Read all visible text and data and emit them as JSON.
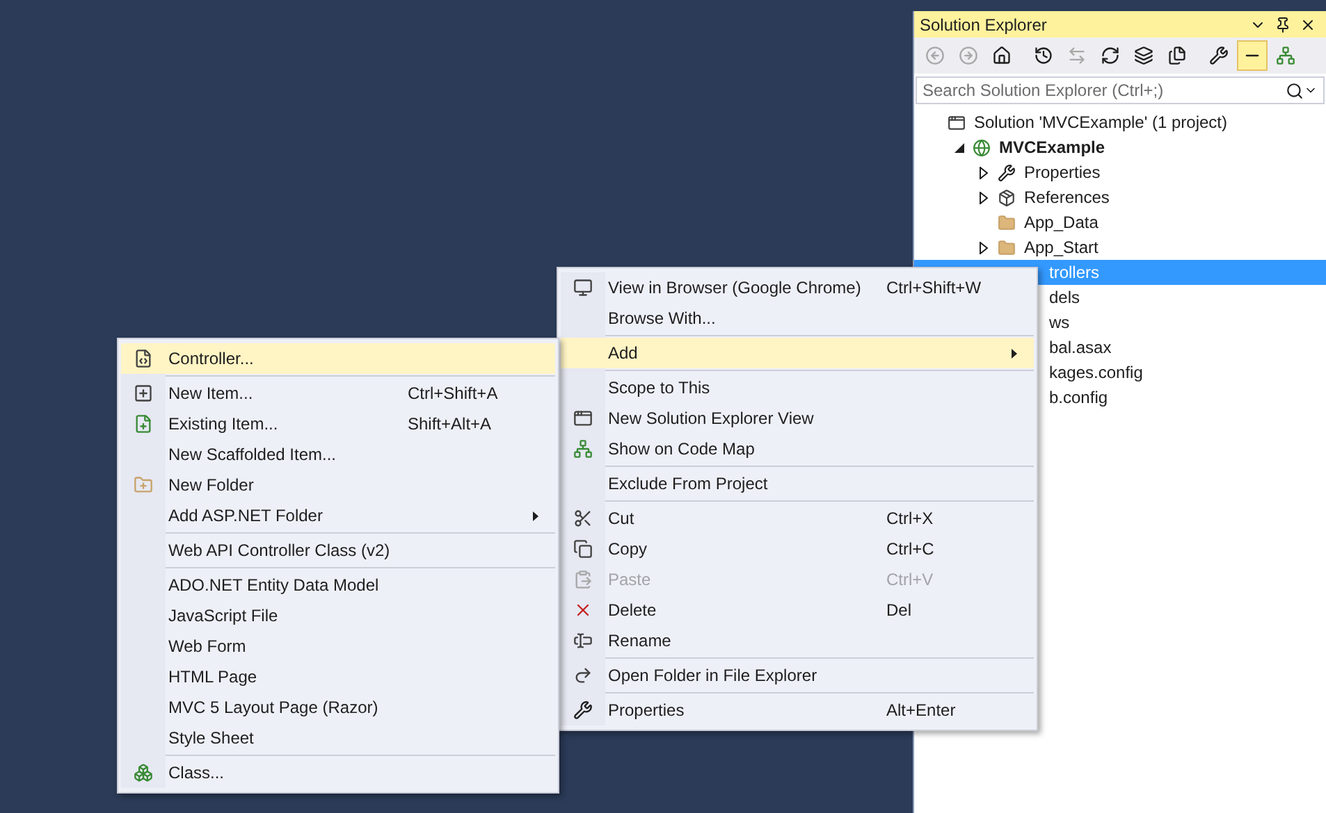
{
  "solution_explorer": {
    "title": "Solution Explorer",
    "toolbar": [
      {
        "kind": "back",
        "disabled": true,
        "pressed": false
      },
      {
        "kind": "forward",
        "disabled": true,
        "pressed": false
      },
      {
        "kind": "home",
        "disabled": false,
        "pressed": false
      },
      {
        "kind": "history",
        "disabled": false,
        "pressed": false
      },
      {
        "kind": "sync",
        "disabled": true,
        "pressed": false
      },
      {
        "kind": "refresh",
        "disabled": false,
        "pressed": false
      },
      {
        "kind": "collapse",
        "disabled": false,
        "pressed": false
      },
      {
        "kind": "show-all",
        "disabled": false,
        "pressed": false
      },
      {
        "kind": "properties",
        "disabled": false,
        "pressed": false
      },
      {
        "kind": "preview",
        "disabled": false,
        "pressed": true
      },
      {
        "kind": "code-map",
        "disabled": false,
        "pressed": false
      }
    ],
    "search": {
      "placeholder": "Search Solution Explorer (Ctrl+;)"
    },
    "tree": [
      {
        "label": "Solution 'MVCExample' (1 project)",
        "kind": "solution",
        "selected": false,
        "children": [
          {
            "label": "MVCExample",
            "kind": "project",
            "expanded": true,
            "selected": false,
            "children": [
              {
                "label": "Properties",
                "kind": "properties",
                "expanded": false,
                "selected": false
              },
              {
                "label": "References",
                "kind": "references",
                "expanded": false,
                "selected": false
              },
              {
                "label": "App_Data",
                "kind": "folder",
                "selected": false
              },
              {
                "label": "App_Start",
                "kind": "folder",
                "expanded": false,
                "selected": false
              },
              {
                "label": "trollers",
                "kind": "clipped",
                "selected": true
              },
              {
                "label": "dels",
                "kind": "clipped",
                "selected": false
              },
              {
                "label": "ws",
                "kind": "clipped",
                "selected": false
              },
              {
                "label": "bal.asax",
                "kind": "clipped",
                "selected": false
              },
              {
                "label": "kages.config",
                "kind": "clipped",
                "selected": false
              },
              {
                "label": "b.config",
                "kind": "clipped",
                "selected": false
              }
            ]
          }
        ]
      }
    ]
  },
  "context_menu": {
    "groups": [
      [
        {
          "label": "View in Browser (Google Chrome)",
          "shortcut": "Ctrl+Shift+W",
          "kind": "browser",
          "selected": false,
          "disabled": false
        },
        {
          "label": "Browse With...",
          "selected": false,
          "disabled": false
        }
      ],
      [
        {
          "label": "Add",
          "selected": true,
          "disabled": false,
          "submenu": true
        }
      ],
      [
        {
          "label": "Scope to This",
          "selected": false,
          "disabled": false
        },
        {
          "label": "New Solution Explorer View",
          "kind": "window",
          "selected": false,
          "disabled": false
        },
        {
          "label": "Show on Code Map",
          "kind": "code-map",
          "selected": false,
          "disabled": false
        }
      ],
      [
        {
          "label": "Exclude From Project",
          "selected": false,
          "disabled": false
        }
      ],
      [
        {
          "label": "Cut",
          "shortcut": "Ctrl+X",
          "kind": "cut",
          "selected": false,
          "disabled": false
        },
        {
          "label": "Copy",
          "shortcut": "Ctrl+C",
          "kind": "copy",
          "selected": false,
          "disabled": false
        },
        {
          "label": "Paste",
          "shortcut": "Ctrl+V",
          "kind": "paste",
          "selected": false,
          "disabled": true
        },
        {
          "label": "Delete",
          "shortcut": "Del",
          "kind": "delete",
          "selected": false,
          "disabled": false
        },
        {
          "label": "Rename",
          "kind": "rename",
          "selected": false,
          "disabled": false
        }
      ],
      [
        {
          "label": "Open Folder in File Explorer",
          "kind": "open",
          "selected": false,
          "disabled": false
        }
      ],
      [
        {
          "label": "Properties",
          "shortcut": "Alt+Enter",
          "kind": "properties",
          "selected": false,
          "disabled": false
        }
      ]
    ]
  },
  "add_submenu": {
    "groups": [
      [
        {
          "label": "Controller...",
          "kind": "controller",
          "selected": true,
          "disabled": false
        }
      ],
      [
        {
          "label": "New Item...",
          "shortcut": "Ctrl+Shift+A",
          "kind": "new-item",
          "selected": false,
          "disabled": false
        },
        {
          "label": "Existing Item...",
          "shortcut": "Shift+Alt+A",
          "kind": "existing-item",
          "selected": false,
          "disabled": false
        },
        {
          "label": "New Scaffolded Item...",
          "selected": false,
          "disabled": false
        },
        {
          "label": "New Folder",
          "kind": "new-folder",
          "selected": false,
          "disabled": false
        },
        {
          "label": "Add ASP.NET Folder",
          "selected": false,
          "disabled": false,
          "submenu": true
        }
      ],
      [
        {
          "label": "Web API Controller Class (v2)",
          "selected": false,
          "disabled": false
        }
      ],
      [
        {
          "label": "ADO.NET Entity Data Model",
          "selected": false,
          "disabled": false
        },
        {
          "label": "JavaScript File",
          "selected": false,
          "disabled": false
        },
        {
          "label": "Web Form",
          "selected": false,
          "disabled": false
        },
        {
          "label": "HTML Page",
          "selected": false,
          "disabled": false
        },
        {
          "label": "MVC 5 Layout Page (Razor)",
          "selected": false,
          "disabled": false
        },
        {
          "label": "Style Sheet",
          "selected": false,
          "disabled": false
        }
      ],
      [
        {
          "label": "Class...",
          "kind": "class",
          "selected": false,
          "disabled": false
        }
      ]
    ]
  }
}
